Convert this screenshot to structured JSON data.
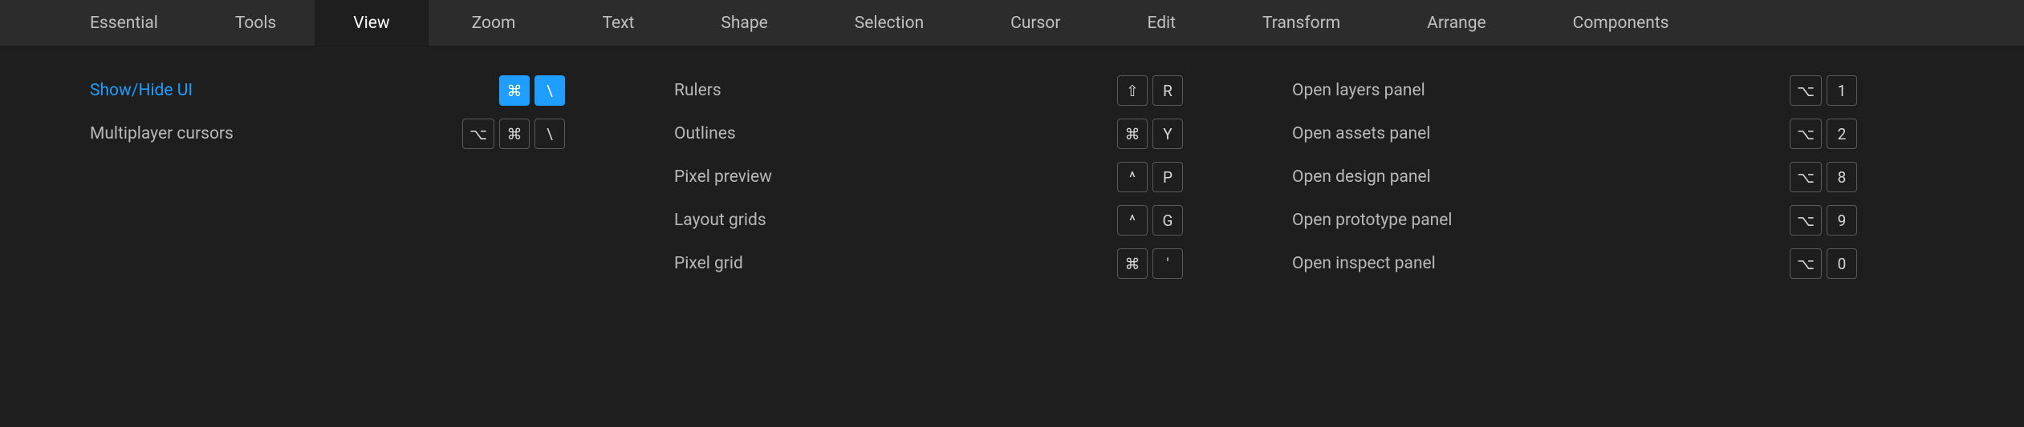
{
  "tabs": [
    {
      "label": "Essential",
      "active": false
    },
    {
      "label": "Tools",
      "active": false
    },
    {
      "label": "View",
      "active": true
    },
    {
      "label": "Zoom",
      "active": false
    },
    {
      "label": "Text",
      "active": false
    },
    {
      "label": "Shape",
      "active": false
    },
    {
      "label": "Selection",
      "active": false
    },
    {
      "label": "Cursor",
      "active": false
    },
    {
      "label": "Edit",
      "active": false
    },
    {
      "label": "Transform",
      "active": false
    },
    {
      "label": "Arrange",
      "active": false
    },
    {
      "label": "Components",
      "active": false
    }
  ],
  "columns": {
    "col1": [
      {
        "label": "Show/Hide UI",
        "highlight": true,
        "keys": [
          "⌘",
          "\\"
        ],
        "keys_highlight": true
      },
      {
        "label": "Multiplayer cursors",
        "highlight": false,
        "keys": [
          "⌥",
          "⌘",
          "\\"
        ],
        "keys_highlight": false
      }
    ],
    "col2": [
      {
        "label": "Rulers",
        "keys": [
          "⇧",
          "R"
        ]
      },
      {
        "label": "Outlines",
        "keys": [
          "⌘",
          "Y"
        ]
      },
      {
        "label": "Pixel preview",
        "keys": [
          "^",
          "P"
        ]
      },
      {
        "label": "Layout grids",
        "keys": [
          "^",
          "G"
        ]
      },
      {
        "label": "Pixel grid",
        "keys": [
          "⌘",
          "'"
        ]
      }
    ],
    "col3": [
      {
        "label": "Open layers panel",
        "keys": [
          "⌥",
          "1"
        ]
      },
      {
        "label": "Open assets panel",
        "keys": [
          "⌥",
          "2"
        ]
      },
      {
        "label": "Open design panel",
        "keys": [
          "⌥",
          "8"
        ]
      },
      {
        "label": "Open prototype panel",
        "keys": [
          "⌥",
          "9"
        ]
      },
      {
        "label": "Open inspect panel",
        "keys": [
          "⌥",
          "0"
        ]
      }
    ]
  }
}
